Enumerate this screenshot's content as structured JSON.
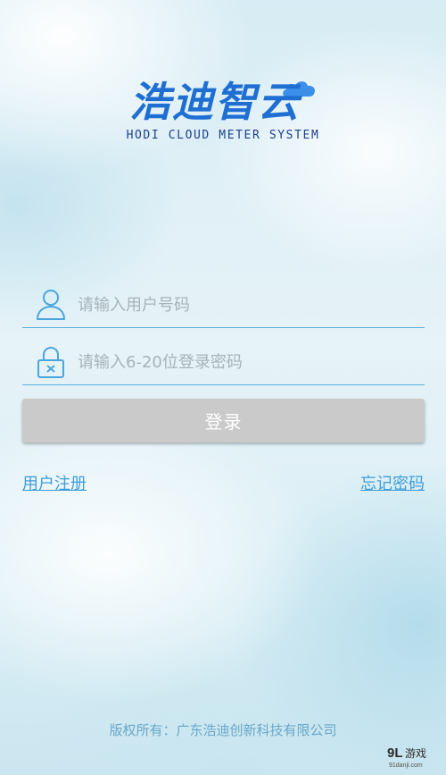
{
  "logo": {
    "title_cn": "浩迪智云",
    "subtitle_en": "HODI CLOUD METER SYSTEM",
    "brand_color": "#1f6fd3",
    "cloud_icon": "cloud-icon"
  },
  "form": {
    "username": {
      "placeholder": "请输入用户号码",
      "value": "",
      "icon": "user-icon"
    },
    "password": {
      "placeholder": "请输入6-20位登录密码",
      "value": "",
      "icon": "lock-icon"
    },
    "login_label": "登录",
    "line_color": "#5bb1e1",
    "button_color": "#cacaca"
  },
  "links": {
    "register": "用户注册",
    "forgot": "忘记密码",
    "color": "#3f9dd9"
  },
  "footer": {
    "copyright": "版权所有：广东浩迪创新科技有限公司"
  },
  "watermark": {
    "brand": "9L游戏",
    "site": "91danji.com"
  }
}
